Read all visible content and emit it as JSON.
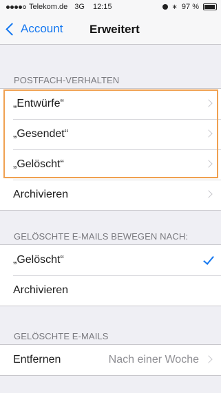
{
  "statusbar": {
    "carrier": "Telekom.de",
    "network": "3G",
    "time": "12:15",
    "battery": "97 %"
  },
  "navbar": {
    "back_label": "Account",
    "title": "Erweitert"
  },
  "sections": {
    "mailbox_behavior": {
      "header": "POSTFACH-VERHALTEN",
      "rows": [
        "„Entwürfe“",
        "„Gesendet“",
        "„Gelöscht“",
        "Archivieren"
      ]
    },
    "move_deleted": {
      "header": "GELÖSCHTE E-MAILS BEWEGEN NACH:",
      "rows": [
        "„Gelöscht“",
        "Archivieren"
      ],
      "selected_index": 0
    },
    "deleted_mails": {
      "header": "GELÖSCHTE E-MAILS",
      "remove_label": "Entfernen",
      "remove_value": "Nach einer Woche"
    }
  },
  "colors": {
    "accent": "#1477f0",
    "highlight": "#f0a050"
  }
}
